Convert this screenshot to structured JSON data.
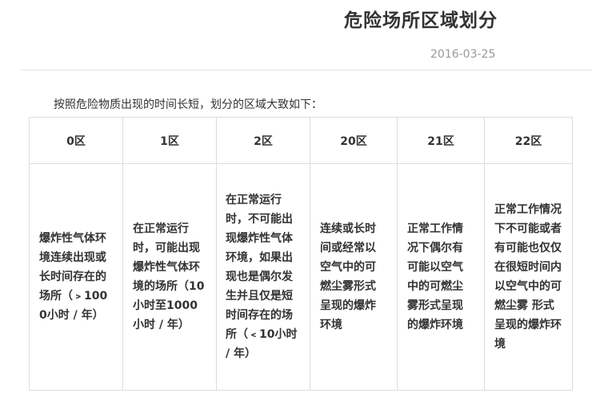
{
  "article": {
    "title": "危险场所区域划分",
    "date": "2016-03-25",
    "intro": "按照危险物质出现的时间长短，划分的区域大致如下："
  },
  "table": {
    "headers": [
      "0区",
      "1区",
      "2区",
      "20区",
      "21区",
      "22区"
    ],
    "cells": [
      "爆炸性气体环境连续出现或长时间存在的场所（﹥1000小时 / 年）",
      "在正常运行时，可能出现爆炸性气体环境的场所（10小时至1000小时 / 年）",
      "在正常运行时，不可能出现爆炸性气体环境，如果出现也是偶尔发生并且仅是短时间存在的场所（﹤10小时 / 年）",
      "连续或长时间或经常以空气中的可燃尘雾形式呈现的爆炸环境",
      "正常工作情况下偶尔有可能以空气中的可燃尘雾形式呈现的爆炸环境",
      "正常工作情况下不可能或者有可能也仅仅在很短时间内以空气中的可燃尘雾 形式呈现的爆炸环境"
    ]
  }
}
